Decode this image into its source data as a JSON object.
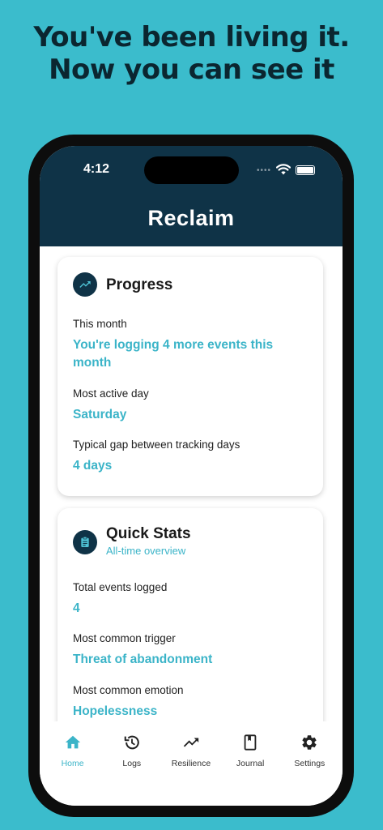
{
  "headline": {
    "line1": "You've been living it.",
    "line2": "Now you can see it"
  },
  "status_bar": {
    "time": "4:12"
  },
  "app": {
    "title": "Reclaim"
  },
  "progress_card": {
    "icon": "trending-up-icon",
    "title": "Progress",
    "items": [
      {
        "label": "This month",
        "value": "You're logging 4 more events this month"
      },
      {
        "label": "Most active day",
        "value": "Saturday"
      },
      {
        "label": "Typical gap between tracking days",
        "value": "4 days"
      }
    ]
  },
  "quick_stats_card": {
    "icon": "clipboard-icon",
    "title": "Quick Stats",
    "subtitle": "All-time overview",
    "items": [
      {
        "label": "Total events logged",
        "value": "4"
      },
      {
        "label": "Most common trigger",
        "value": "Threat of abandonment"
      },
      {
        "label": "Most common emotion",
        "value": "Hopelessness"
      }
    ]
  },
  "nav": {
    "items": [
      {
        "label": "Home",
        "icon": "home-icon",
        "active": true
      },
      {
        "label": "Logs",
        "icon": "history-icon",
        "active": false
      },
      {
        "label": "Resilience",
        "icon": "trending-up-icon",
        "active": false
      },
      {
        "label": "Journal",
        "icon": "book-icon",
        "active": false
      },
      {
        "label": "Settings",
        "icon": "gear-icon",
        "active": false
      }
    ]
  },
  "colors": {
    "background": "#3bbccc",
    "app_bar": "#0f3347",
    "accent": "#3bb4c8",
    "headline": "#0b2630"
  }
}
